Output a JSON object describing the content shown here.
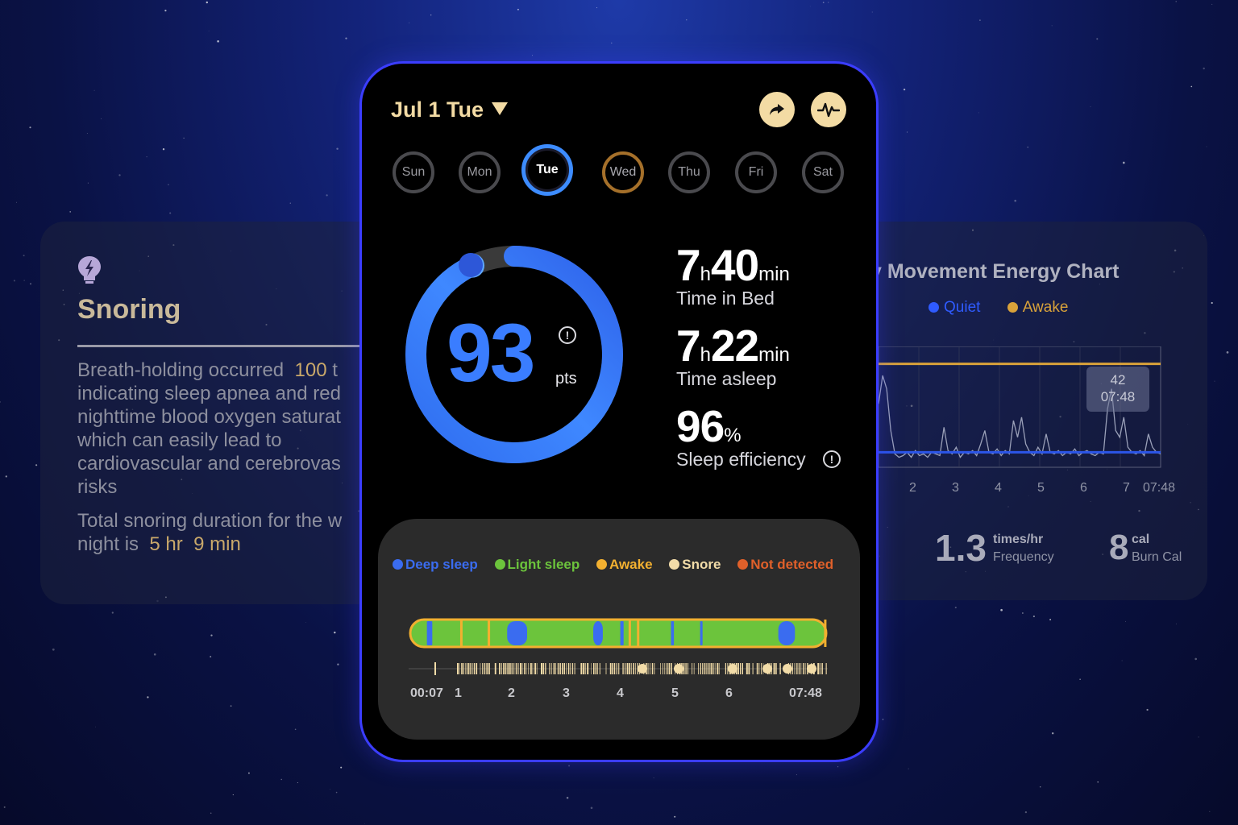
{
  "colors": {
    "accent_gold": "#f3dba4",
    "score_blue": "#3a7dff",
    "deep": "#3a6cf0",
    "light": "#6cc43c",
    "awake": "#f2b030",
    "snore": "#f2dca8",
    "not_detected": "#e0602a"
  },
  "snoring_card": {
    "icon": "bolt-icon",
    "title": "Snoring",
    "line1_prefix": "Breath-holding occurred",
    "line1_value": "100",
    "line1_suffix": "t",
    "line2": "indicating sleep apnea and red",
    "line3": "nighttime blood oxygen saturat",
    "line4": "which can easily lead to",
    "line5": "cardiovascular and cerebrovas",
    "line6": "risks",
    "total_line1": "Total snoring duration for the w",
    "total_prefix": "night is",
    "total_hr_value": "5",
    "total_hr_unit": "hr",
    "total_min_value": "9",
    "total_min_unit": "min"
  },
  "movement_card": {
    "title": "y Movement Energy Chart",
    "legend_quiet": "Quiet",
    "legend_awake": "Awake",
    "tooltip_value": "42",
    "tooltip_time": "07:48",
    "x_ticks": [
      "2",
      "3",
      "4",
      "5",
      "6",
      "7",
      "07:48"
    ],
    "frequency_value": "1.3",
    "frequency_unit": "times/hr",
    "frequency_label": "Frequency",
    "burn_value": "8",
    "burn_unit": "cal",
    "burn_label": "Burn Cal"
  },
  "chart_data": {
    "type": "line",
    "title": "y Movement Energy Chart",
    "series": [
      {
        "name": "Quiet",
        "color": "#2b55e8"
      },
      {
        "name": "Awake",
        "color": "#d9a23a"
      }
    ],
    "x_ticks": [
      "2",
      "3",
      "4",
      "5",
      "6",
      "7",
      "07:48"
    ],
    "y": [
      38,
      55,
      47,
      22,
      8,
      6,
      7,
      9,
      6,
      10,
      7,
      8,
      6,
      9,
      8,
      7,
      24,
      10,
      8,
      12,
      6,
      9,
      8,
      10,
      7,
      14,
      22,
      9,
      8,
      11,
      7,
      10,
      8,
      28,
      18,
      30,
      14,
      9,
      7,
      12,
      8,
      20,
      9,
      8,
      10,
      7,
      9,
      8,
      11,
      7,
      9,
      10,
      8,
      7,
      9,
      8,
      35,
      47,
      22,
      18,
      30,
      12,
      9,
      8,
      10,
      7,
      20,
      12,
      9,
      8
    ],
    "quiet_level": 9,
    "awake_level": 62,
    "tooltip": {
      "value": 42,
      "time": "07:48"
    }
  },
  "header": {
    "date": "Jul 1 Tue",
    "share_icon": "share-icon",
    "pulse_icon": "pulse-icon"
  },
  "days": [
    {
      "label": "Sun",
      "state": "default"
    },
    {
      "label": "Mon",
      "state": "default"
    },
    {
      "label": "Tue",
      "state": "active"
    },
    {
      "label": "Wed",
      "state": "partial"
    },
    {
      "label": "Thu",
      "state": "default"
    },
    {
      "label": "Fri",
      "state": "default"
    },
    {
      "label": "Sat",
      "state": "default"
    }
  ],
  "score": {
    "value": "93",
    "unit": "pts",
    "fraction": 0.93
  },
  "metrics": {
    "bed_h": "7",
    "bed_h_unit": "h",
    "bed_m": "40",
    "bed_m_unit": "min",
    "bed_label": "Time in Bed",
    "asleep_h": "7",
    "asleep_h_unit": "h",
    "asleep_m": "22",
    "asleep_m_unit": "min",
    "asleep_label": "Time asleep",
    "efficiency_value": "96",
    "efficiency_unit": "%",
    "efficiency_label": "Sleep efficiency"
  },
  "sleep_legend": {
    "deep": "Deep sleep",
    "light": "Light sleep",
    "awake": "Awake",
    "snore": "Snore",
    "not_detected": "Not detected"
  },
  "timeline": {
    "start": "00:07",
    "end": "07:48",
    "hours": [
      "1",
      "2",
      "3",
      "4",
      "5",
      "6"
    ],
    "deep_segments": [
      [
        0.04,
        0.053
      ],
      [
        0.233,
        0.281
      ],
      [
        0.44,
        0.463
      ],
      [
        0.505,
        0.513
      ],
      [
        0.627,
        0.634
      ],
      [
        0.697,
        0.7
      ],
      [
        0.885,
        0.925
      ]
    ],
    "awake_segments": [
      [
        0.12,
        0.125
      ],
      [
        0.186,
        0.192
      ],
      [
        0.525,
        0.528
      ],
      [
        0.545,
        0.548
      ],
      [
        0.995,
        1.0
      ]
    ]
  }
}
